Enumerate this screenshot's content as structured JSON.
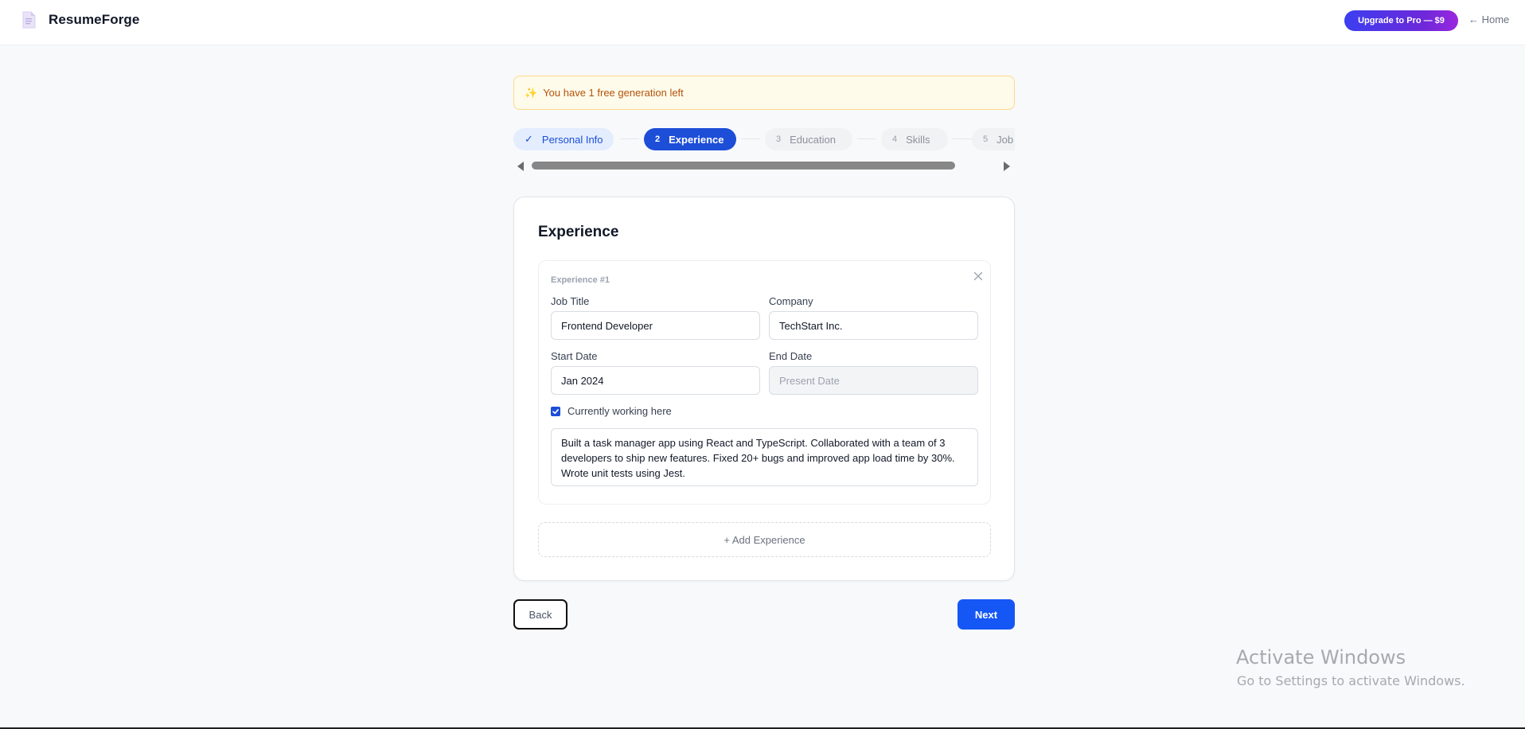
{
  "app": {
    "brand": "ResumeForge",
    "upgrade_label": "Upgrade to Pro — $9",
    "home_label": "← Home"
  },
  "banner": {
    "icon": "sparkle-icon",
    "text": "You have 1 free generation left"
  },
  "steps": [
    {
      "num": "✓",
      "label": "Personal Info",
      "state": "done"
    },
    {
      "num": "2",
      "label": "Experience",
      "state": "active"
    },
    {
      "num": "3",
      "label": "Education",
      "state": "todo"
    },
    {
      "num": "4",
      "label": "Skills",
      "state": "todo"
    },
    {
      "num": "5",
      "label": "Job",
      "state": "todo"
    }
  ],
  "section": {
    "title": "Experience",
    "experiences": [
      {
        "label": "Experience #1",
        "job_title_label": "Job Title",
        "job_title": "Frontend Developer",
        "company_label": "Company",
        "company": "TechStart Inc.",
        "start_label": "Start Date",
        "start_date": "Jan 2024",
        "end_label": "End Date",
        "end_placeholder": "Present Date",
        "current_label": "Currently working here",
        "current": true,
        "description": "Built a task manager app using React and TypeScript. Collaborated with a team of 3 developers to ship new features. Fixed 20+ bugs and improved app load time by 30%. Wrote unit tests using Jest."
      }
    ],
    "add_label": "+ Add Experience"
  },
  "nav": {
    "back_label": "Back",
    "next_label": "Next"
  },
  "watermark": {
    "title": "Activate Windows",
    "subtitle": "Go to Settings to activate Windows."
  },
  "colors": {
    "primary": "#1d4ed8",
    "next_button": "#1557f5",
    "banner_bg": "#fffbeb",
    "banner_text": "#b45309",
    "upgrade_gradient_start": "#3b3ff0",
    "upgrade_gradient_end": "#9b27e0"
  }
}
